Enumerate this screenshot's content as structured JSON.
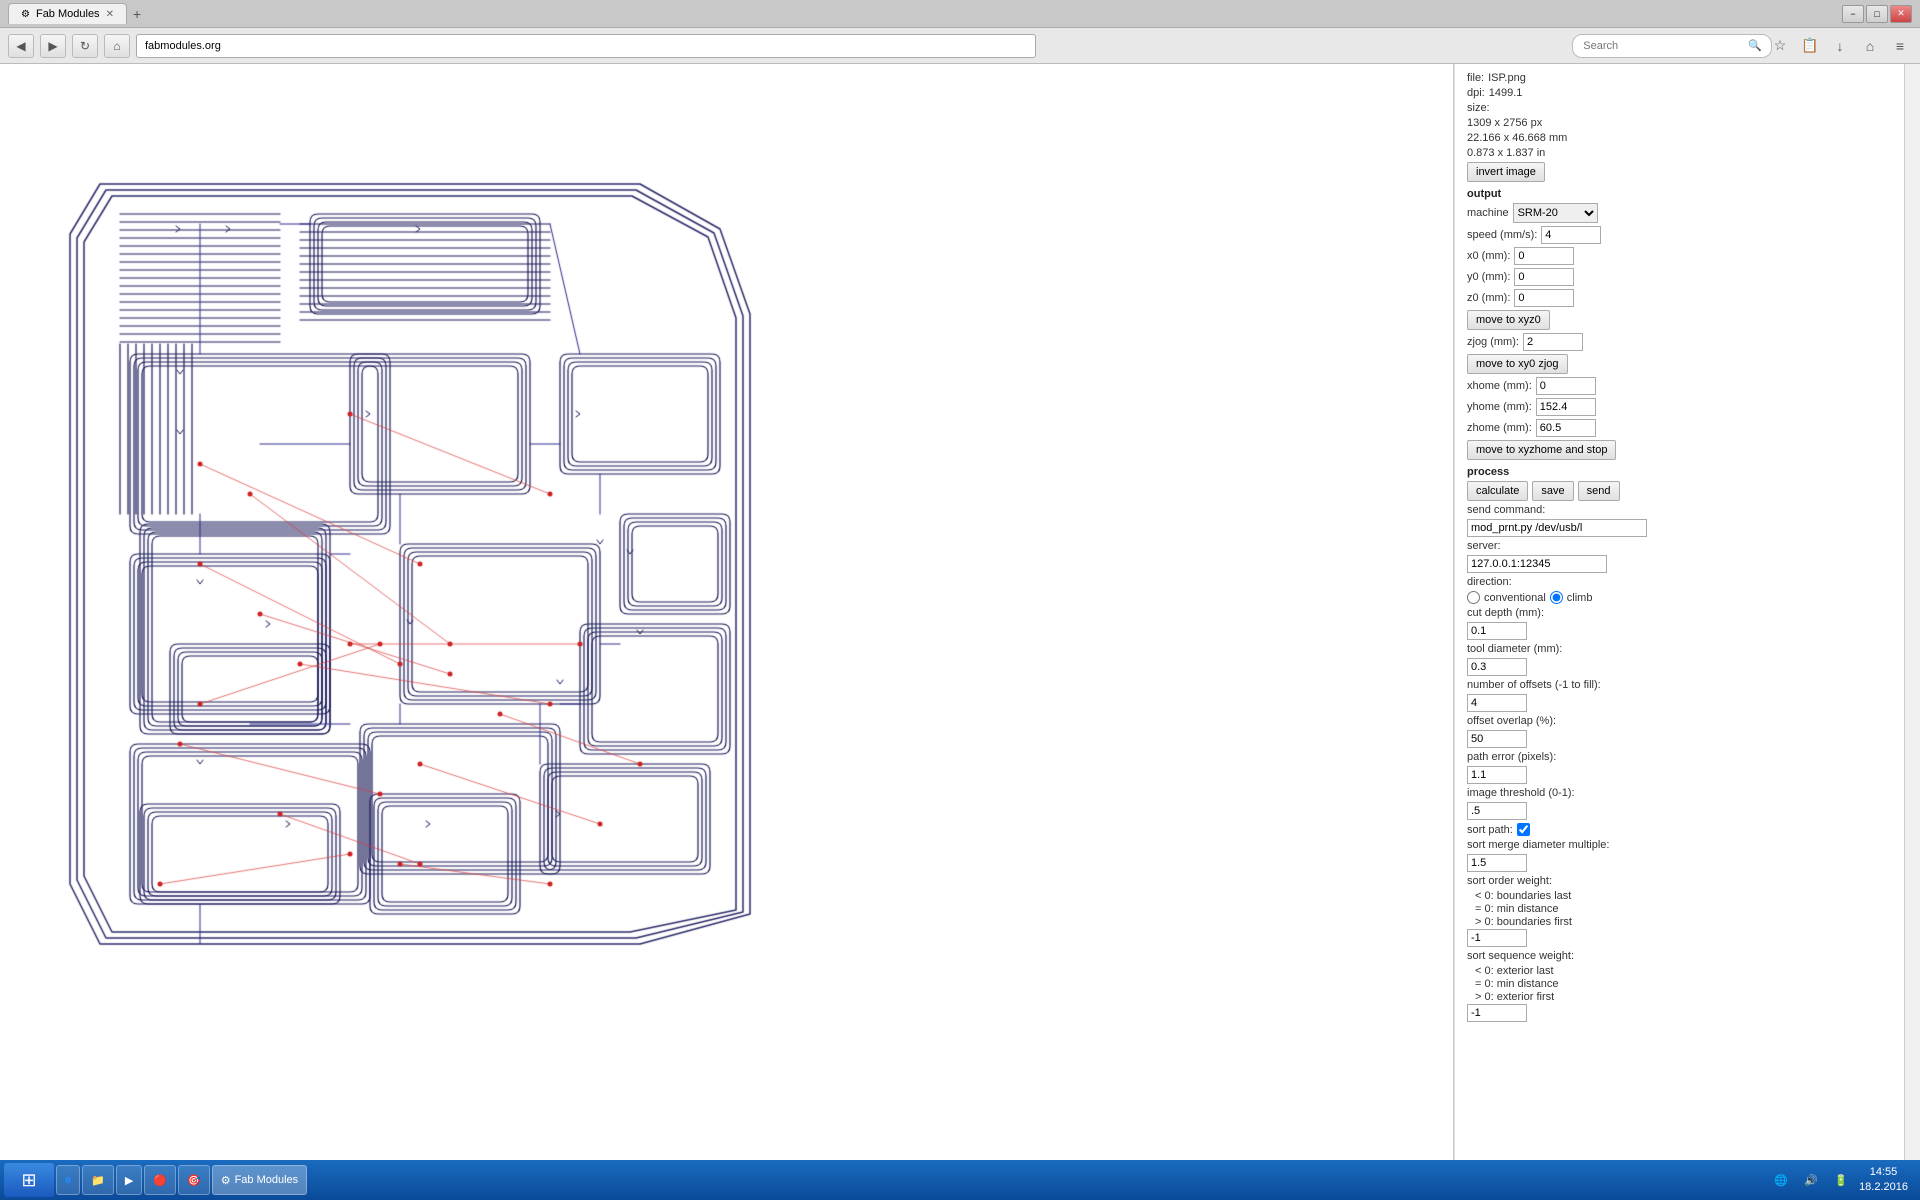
{
  "browser": {
    "tab_title": "Fab Modules",
    "url": "fabmodules.org",
    "search_placeholder": "Search",
    "new_tab_symbol": "+",
    "window_controls": [
      "−",
      "□",
      "✕"
    ]
  },
  "nav_icons": [
    "◀",
    "▶",
    "↻",
    "🏠"
  ],
  "right_panel": {
    "file_label": "file:",
    "file_value": "ISP.png",
    "dpi_label": "dpi:",
    "dpi_value": "1499.1",
    "size_label": "size:",
    "size_px": "1309 x 2756 px",
    "size_mm": "22.166 x 46.668 mm",
    "size_in": "0.873 x 1.837 in",
    "invert_image_btn": "invert image",
    "output_title": "output",
    "machine_label": "machine",
    "machine_value": "SRM-20",
    "speed_label": "speed (mm/s):",
    "speed_value": "4",
    "x0_label": "x0 (mm):",
    "x0_value": "0",
    "y0_label": "y0 (mm):",
    "y0_value": "0",
    "z0_label": "z0 (mm):",
    "z0_value": "0",
    "move_xyz0_btn": "move to xyz0",
    "zjog_label": "zjog (mm):",
    "zjog_value": "2",
    "move_xyz0_zjog_btn": "move to xy0 zjog",
    "xhome_label": "xhome (mm):",
    "xhome_value": "0",
    "yhome_label": "yhome (mm):",
    "yhome_value": "152.4",
    "zhome_label": "zhome (mm):",
    "zhome_value": "60.5",
    "move_xyzhome_btn": "move to xyzhome and stop",
    "process_title": "process",
    "calculate_btn": "calculate",
    "save_btn": "save",
    "send_btn": "send",
    "send_command_label": "send command:",
    "send_command_value": "mod_prnt.py /dev/usb/l",
    "server_label": "server:",
    "server_value": "127.0.0.1:12345",
    "direction_label": "direction:",
    "conventional_label": "conventional",
    "climb_label": "climb",
    "cut_depth_label": "cut depth (mm):",
    "cut_depth_value": "0.1",
    "tool_diameter_label": "tool diameter (mm):",
    "tool_diameter_value": "0.3",
    "num_offsets_label": "number of offsets (-1 to fill):",
    "num_offsets_value": "4",
    "offset_overlap_label": "offset overlap (%):",
    "offset_overlap_value": "50",
    "path_error_label": "path error (pixels):",
    "path_error_value": "1.1",
    "image_threshold_label": "image threshold (0-1):",
    "image_threshold_value": ".5",
    "sort_path_label": "sort path:",
    "sort_path_checked": true,
    "sort_merge_label": "sort merge diameter multiple:",
    "sort_merge_value": "1.5",
    "sort_order_label": "sort order weight:",
    "sort_order_line1": "< 0: boundaries last",
    "sort_order_line2": "= 0: min distance",
    "sort_order_line3": "> 0: boundaries first",
    "sort_order_value": "-1",
    "sort_sequence_label": "sort sequence weight:",
    "sort_sequence_line1": "< 0: exterior last",
    "sort_sequence_line2": "= 0: min distance",
    "sort_sequence_line3": "> 0: exterior first",
    "sort_sequence_value": "-1"
  },
  "taskbar": {
    "time": "14:55",
    "date": "18.2.2016",
    "items": [
      {
        "label": "⊞",
        "icon": true
      },
      {
        "label": "IE",
        "icon": false
      },
      {
        "label": "📁",
        "icon": true
      },
      {
        "label": "▶",
        "icon": true
      },
      {
        "label": "🔴",
        "icon": true
      },
      {
        "label": "Fab Modules",
        "active": true
      }
    ]
  }
}
